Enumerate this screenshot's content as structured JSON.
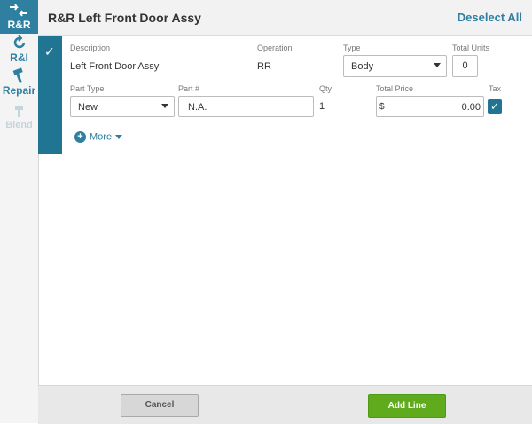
{
  "rail": {
    "rr_label": "R&R",
    "ri_label": "R&I",
    "repair_label": "Repair",
    "blend_label": "Blend"
  },
  "header": {
    "title": "R&R Left Front Door Assy",
    "deselect_all": "Deselect All"
  },
  "line": {
    "description_label": "Description",
    "description_value": "Left Front Door Assy",
    "operation_label": "Operation",
    "operation_value": "RR",
    "type_label": "Type",
    "type_value": "Body",
    "total_units_label": "Total Units",
    "total_units_value": "0",
    "part_type_label": "Part Type",
    "part_type_value": "New",
    "part_num_label": "Part #",
    "part_num_value": "N.A.",
    "qty_label": "Qty",
    "qty_value": "1",
    "total_price_label": "Total Price",
    "currency_symbol": "$",
    "total_price_value": "0.00",
    "tax_label": "Tax",
    "more_label": "More"
  },
  "footer": {
    "cancel_label": "Cancel",
    "add_line_label": "Add Line"
  },
  "colors": {
    "accent": "#2f7fa1",
    "band": "#1f7592",
    "add_button": "#5fab1d"
  }
}
